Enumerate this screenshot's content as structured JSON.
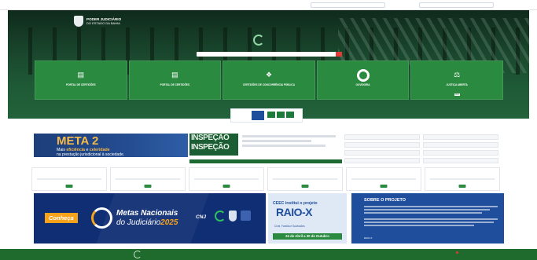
{
  "header": {
    "org_line1": "PODER JUDICIÁRIO",
    "org_line2": "DO ESTADO DA BAHIA"
  },
  "cards": [
    {
      "title": "PORTAL DE CERTIDÕES",
      "badge": ""
    },
    {
      "title": "PORTAL DE CERTIDÕES",
      "badge": ""
    },
    {
      "title": "CERTIDÕES DE CONCORRÊNCIA PÚBLICA",
      "badge": ""
    },
    {
      "title": "OUVIDORIA",
      "badge": ""
    },
    {
      "title": "JUSTIÇA ABERTA",
      "badge": "CNJ"
    }
  ],
  "news": {
    "meta_title": "META 2",
    "meta_line1_pre": "Mais ",
    "meta_line1_em": "eficiência",
    "meta_line1_mid": " e ",
    "meta_line1_em2": "celeridade",
    "meta_line2": "na prestação jurisdicional à sociedade.",
    "inspecao_1": "INSPEÇÃO",
    "inspecao_2": "INSPEÇÃO"
  },
  "banners": {
    "conheca": "Conheça",
    "metas_line1": "Metas Nacionais",
    "metas_line2_pre": "do Judiciário",
    "metas_line2_year": "2025",
    "cnj": "CNJ",
    "raio_title": "CEEC institui o projeto",
    "raio_name": "RAIO-X",
    "raio_sub": "Cível, Família e Sucessões",
    "raio_dates": "24 de Abril a 30 de Outubro",
    "sobre_title": "SOBRE O PROJETO",
    "sobre_logo": "RAIO-X"
  }
}
